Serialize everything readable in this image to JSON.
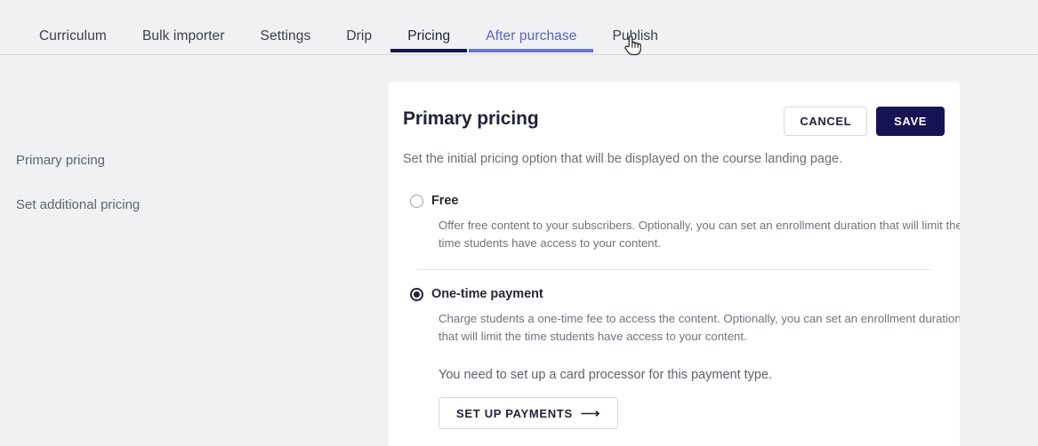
{
  "colors": {
    "page_background": "#eff1f3",
    "card_background": "#ffffff",
    "navy": "#161355",
    "active_tab_underline": "#1a1747",
    "hover_tab_underline": "#6c74c6",
    "hover_tab_text": "#5b63c4",
    "divider": "#e3e5e8",
    "muted_text": "#6e747d"
  },
  "topbar": {
    "tabs": [
      {
        "label": "Curriculum",
        "state": "default"
      },
      {
        "label": "Bulk importer",
        "state": "default"
      },
      {
        "label": "Settings",
        "state": "default"
      },
      {
        "label": "Drip",
        "state": "default"
      },
      {
        "label": "Pricing",
        "state": "active"
      },
      {
        "label": "After purchase",
        "state": "hover"
      },
      {
        "label": "Publish",
        "state": "default"
      }
    ]
  },
  "sidebar": {
    "items": [
      {
        "label": "Primary pricing"
      },
      {
        "label": "Set additional pricing"
      }
    ]
  },
  "card": {
    "title": "Primary pricing",
    "cancel_label": "CANCEL",
    "save_label": "SAVE",
    "subtitle": "Set the initial pricing option that will be displayed on the course landing page.",
    "options": [
      {
        "label": "Free",
        "selected": false,
        "description": "Offer free content to your subscribers. Optionally, you can set an enrollment duration that will limit the time students have access to your content."
      },
      {
        "label": "One-time payment",
        "selected": true,
        "description": "Charge students a one-time fee to access the content. Optionally, you can set an enrollment duration that will limit the time students have access to your content."
      }
    ],
    "note": "You need to set up a card processor for this payment type.",
    "setup_button_label": "SET UP PAYMENTS",
    "setup_button_icon": "arrow-right-icon"
  },
  "cursor": {
    "icon": "pointer-hand-cursor"
  }
}
